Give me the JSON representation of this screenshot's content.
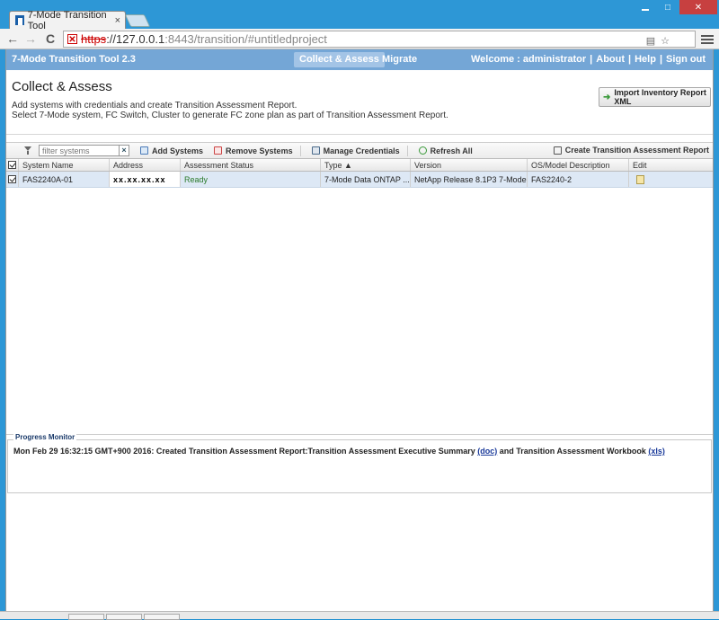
{
  "browser": {
    "tab_title": "7-Mode Transition Tool",
    "tab_close": "×",
    "url_scheme": "https",
    "url_host": "://127.0.0.1",
    "url_path": ":8443/transition/#untitledproject",
    "win_max": "□",
    "win_close": "✕",
    "back": "←",
    "forward": "→",
    "reload": "C"
  },
  "app": {
    "brand": "7-Mode Transition Tool 2.3",
    "nav": [
      "Collect & Assess",
      "Migrate"
    ],
    "welcome": "Welcome : administrator",
    "links": [
      "About",
      "Help",
      "Sign out"
    ],
    "sep": "|"
  },
  "section": {
    "title": "Collect & Assess",
    "desc1": "Add systems with credentials and create Transition Assessment Report.",
    "desc2": "Select 7-Mode system, FC Switch, Cluster to generate FC zone plan as part of Transition Assessment Report.",
    "import_label": "Import Inventory Report XML"
  },
  "gridbar": {
    "filter_placeholder": "filter systems",
    "clear": "×",
    "add": "Add Systems",
    "remove": "Remove Systems",
    "credentials": "Manage Credentials",
    "refresh": "Refresh All",
    "create_report": "Create Transition Assessment Report"
  },
  "grid": {
    "columns": [
      "System Name",
      "Address",
      "Assessment Status",
      "Type ▲",
      "Version",
      "OS/Model Description",
      "Edit"
    ],
    "rows": [
      {
        "name": "FAS2240A-01",
        "address": "xx.xx.xx.xx",
        "status": "Ready",
        "type": "7-Mode Data ONTAP ...",
        "version": "NetApp Release 8.1P3 7-Mode",
        "model": "FAS2240-2"
      }
    ]
  },
  "progress": {
    "title": "Progress Monitor",
    "message": "Mon Feb 29 16:32:15 GMT+900 2016: Created Transition Assessment Report:Transition Assessment Executive Summary ",
    "link1": "(doc)",
    "mid": " and Transition Assessment Workbook ",
    "link2": "(xls)"
  },
  "colors": {
    "window_frame": "#2d97d6",
    "app_header": "#74a6d6",
    "selected_row": "#dde8f5",
    "status_ready": "#2a7a2a"
  }
}
